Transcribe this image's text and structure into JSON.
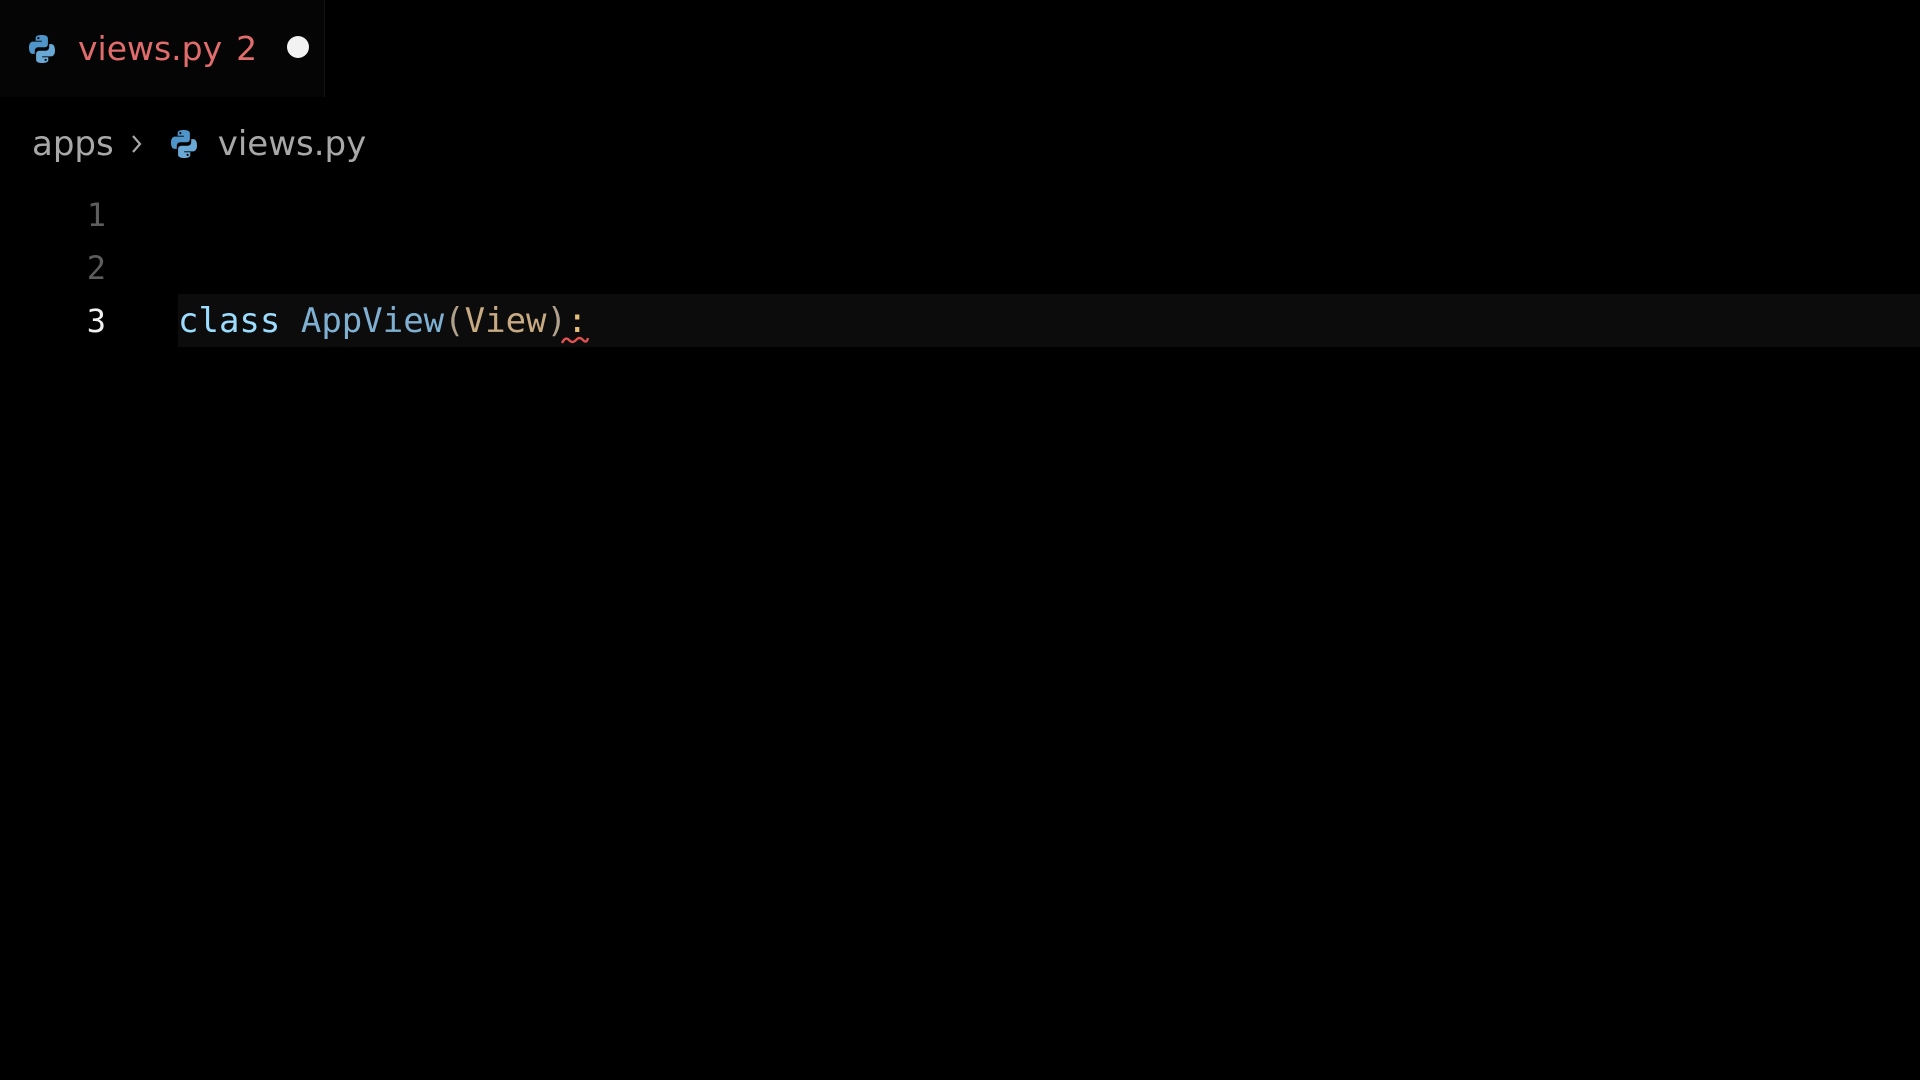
{
  "tab": {
    "icon": "python-icon",
    "label": "views.py",
    "problem_count": "2",
    "dirty_indicator": "unsaved-dot"
  },
  "breadcrumb": {
    "items": [
      "apps",
      "views.py"
    ],
    "separator_icon": "chevron-right-icon",
    "file_icon": "python-icon"
  },
  "editor": {
    "lines": [
      {
        "number": "1",
        "text": ""
      },
      {
        "number": "2",
        "text": ""
      },
      {
        "number": "3",
        "tokens": [
          "class",
          " ",
          "AppView",
          "(",
          "View",
          ")",
          ":"
        ]
      }
    ],
    "current_line": "3",
    "error_marker": "squiggle-under-colon"
  },
  "colors": {
    "background": "#000000",
    "tab_label_error": "#e06c6c",
    "keyword": "#9cdcfe",
    "class_name": "#7fb0d2",
    "base_class": "#c7aa82",
    "error_squiggle": "#e05252"
  }
}
